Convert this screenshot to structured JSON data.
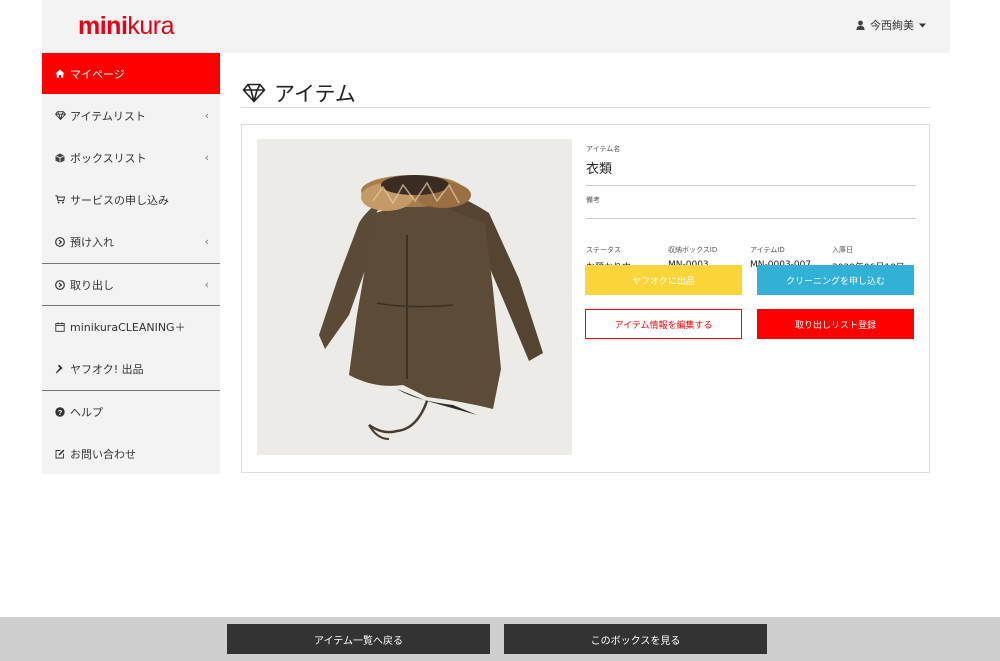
{
  "header": {
    "logo_bold": "mini",
    "logo_light": "kura",
    "user_name": "今西絢美"
  },
  "sidebar": {
    "items": [
      {
        "label": "マイページ",
        "icon": "home-icon"
      },
      {
        "label": "アイテムリスト",
        "icon": "diamond-icon"
      },
      {
        "label": "ボックスリスト",
        "icon": "box-icon"
      },
      {
        "label": "サービスの申し込み",
        "icon": "cart-icon"
      },
      {
        "label": "預け入れ",
        "icon": "arrow-circle-icon"
      },
      {
        "label": "取り出し",
        "icon": "arrow-circle-icon"
      },
      {
        "label": "minikuraCLEANING＋",
        "icon": "calendar-icon"
      },
      {
        "label": "ヤフオク! 出品",
        "icon": "gavel-icon"
      },
      {
        "label": "ヘルプ",
        "icon": "question-circle-icon"
      },
      {
        "label": "お問い合わせ",
        "icon": "edit-icon"
      }
    ],
    "chevron": "‹"
  },
  "main": {
    "title": "アイテム",
    "item_name_label": "アイテム名",
    "item_name": "衣類",
    "note_label": "備考",
    "status_label": "ステータス",
    "status": "お預かり中",
    "box_id_label": "収納ボックスID",
    "box_id": "MN-0003",
    "item_id_label": "アイテムID",
    "item_id": "MN-0003-007",
    "date_label": "入庫日",
    "date": "2020年06月10日",
    "buttons": {
      "yahoo": "ヤフオクに出品",
      "cleaning": "クリーニングを申し込む",
      "edit": "アイテム情報を編集する",
      "retrieve": "取り出しリスト登録"
    }
  },
  "footer": {
    "back": "アイテム一覧へ戻る",
    "view_box": "このボックスを見る"
  },
  "colors": {
    "brand_red": "#ff0000",
    "yellow": "#fbd53a",
    "blue": "#33b0d5",
    "dark": "#333333"
  }
}
